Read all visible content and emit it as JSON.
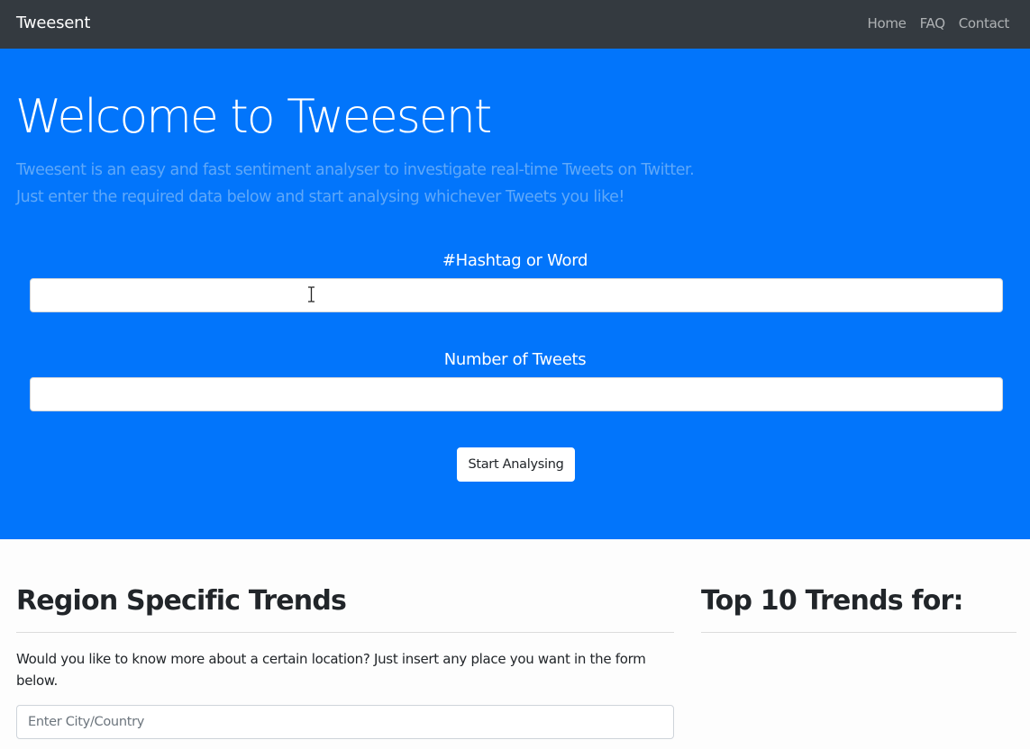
{
  "navbar": {
    "brand": "Tweesent",
    "links": [
      "Home",
      "FAQ",
      "Contact"
    ]
  },
  "hero": {
    "title": "Welcome to Tweesent",
    "lead_line1": "Tweesent is an easy and fast sentiment analyser to investigate real-time Tweets on Twitter.",
    "lead_line2": "Just enter the required data below and start analysing whichever Tweets you like!",
    "hashtag_label": "#Hashtag or Word",
    "hashtag_value": "",
    "tweets_label": "Number of Tweets",
    "tweets_value": "",
    "submit_label": "Start Analysing"
  },
  "region": {
    "title": "Region Specific Trends",
    "text": "Would you like to know more about a certain location? Just insert any place you want in the form below.",
    "input_placeholder": "Enter City/Country",
    "input_value": ""
  },
  "trends": {
    "title": "Top 10 Trends for:"
  },
  "colors": {
    "navbar_bg": "#343a40",
    "hero_bg": "#0275fb",
    "lead_text": "#5fa8f9"
  },
  "icons": {
    "text_cursor": "text-cursor-icon"
  }
}
